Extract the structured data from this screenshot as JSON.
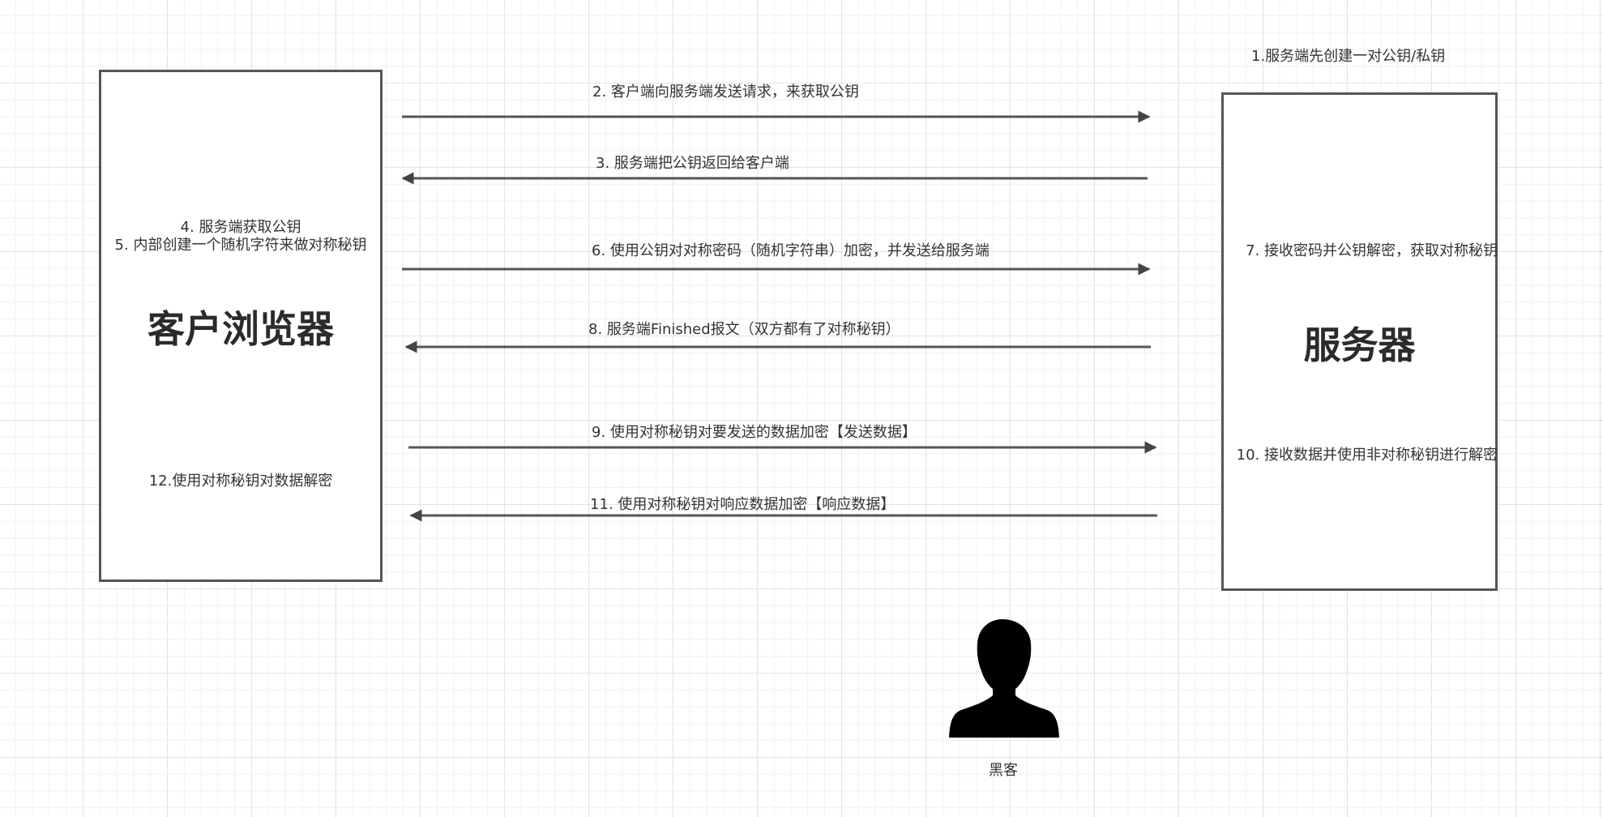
{
  "client": {
    "title": "客户浏览器",
    "note_4": "4. 服务端获取公钥",
    "note_5": "5. 内部创建一个随机字符来做对称秘钥",
    "note_12": "12.使用对称秘钥对数据解密"
  },
  "server": {
    "title": "服务器",
    "note_1": "1.服务端先创建一对公钥/私钥",
    "note_7": "7. 接收密码并公钥解密，获取对称秘钥",
    "note_10": "10. 接收数据并使用非对称秘钥进行解密"
  },
  "messages": [
    {
      "label": "2. 客户端向服务端发送请求，来获取公钥",
      "direction": "to-server"
    },
    {
      "label": "3. 服务端把公钥返回给客户端",
      "direction": "to-client"
    },
    {
      "label": "6. 使用公钥对对称密码（随机字符串）加密，并发送给服务端",
      "direction": "to-server"
    },
    {
      "label": "8. 服务端Finished报文（双方都有了对称秘钥）",
      "direction": "to-client"
    },
    {
      "label": "9. 使用对称秘钥对要发送的数据加密【发送数据】",
      "direction": "to-server"
    },
    {
      "label": "11. 使用对称秘钥对响应数据加密【响应数据】",
      "direction": "to-client"
    }
  ],
  "hacker": {
    "label": "黑客",
    "icon": "person-silhouette-icon"
  }
}
